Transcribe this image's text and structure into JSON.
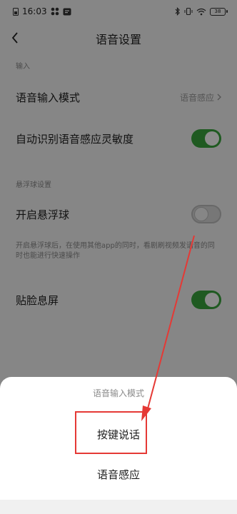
{
  "status_bar": {
    "time": "16:03",
    "battery": "38"
  },
  "header": {
    "title": "语音设置"
  },
  "sections": {
    "input_label": "输入",
    "float_label": "悬浮球设置"
  },
  "settings": {
    "input_mode_label": "语音输入模式",
    "input_mode_value": "语音感应",
    "auto_sensitivity_label": "自动识别语音感应灵敏度",
    "auto_sensitivity_on": true,
    "float_ball_label": "开启悬浮球",
    "float_ball_on": false,
    "float_ball_desc": "开启悬浮球后，在使用其他app的同时，看剧刷视频发语音的同时也能进行快速操作",
    "face_off_label": "贴脸息屏",
    "face_off_on": true
  },
  "sheet": {
    "title": "语音输入模式",
    "options": [
      "按键说话",
      "语音感应"
    ],
    "highlighted_option": "按键说话"
  },
  "colors": {
    "toggle_on": "#3aa53d",
    "highlight": "#e53935",
    "overlay": "rgba(0,0,0,0.45)"
  },
  "icons": {
    "back": "chevron-left-icon",
    "chevron": "chevron-right-icon"
  }
}
